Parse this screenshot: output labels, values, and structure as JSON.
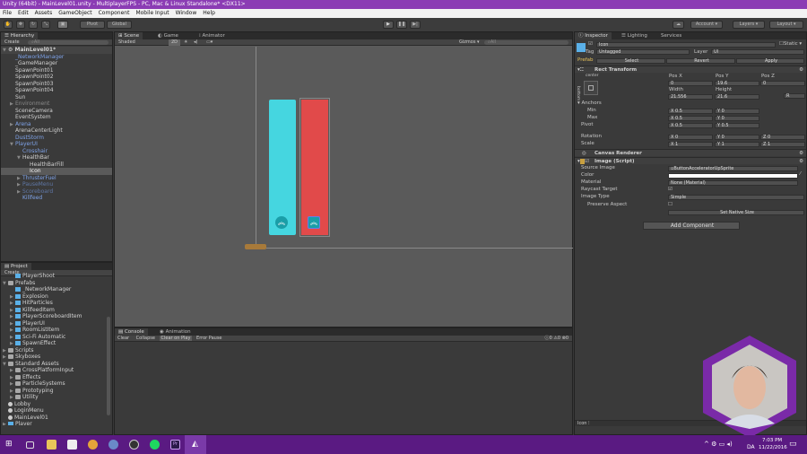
{
  "window": {
    "title": "Unity (64bit) - MainLevel01.unity - MultiplayerFPS - PC, Mac & Linux Standalone* <DX11>"
  },
  "menu": [
    "File",
    "Edit",
    "Assets",
    "GameObject",
    "Component",
    "Mobile Input",
    "Window",
    "Help"
  ],
  "toolbar": {
    "pivot": "Pivot",
    "global": "Global",
    "account": "Account",
    "layers": "Layers",
    "layout": "Layout"
  },
  "hierarchy": {
    "tab": "Hierarchy",
    "create": "Create",
    "search_placeholder": "All",
    "items": [
      {
        "label": "MainLevel01*",
        "indent": 0,
        "type": "sceneroot",
        "arrow": "open"
      },
      {
        "label": "_NetworkManager",
        "indent": 1,
        "type": "prefab"
      },
      {
        "label": "_GameManager",
        "indent": 1,
        "type": "normal"
      },
      {
        "label": "SpawnPoint01",
        "indent": 1,
        "type": "normal"
      },
      {
        "label": "SpawnPoint02",
        "indent": 1,
        "type": "normal"
      },
      {
        "label": "SpawnPoint03",
        "indent": 1,
        "type": "normal"
      },
      {
        "label": "SpawnPoint04",
        "indent": 1,
        "type": "normal"
      },
      {
        "label": "Sun",
        "indent": 1,
        "type": "normal"
      },
      {
        "label": "Environment",
        "indent": 1,
        "type": "inactive",
        "arrow": "closed"
      },
      {
        "label": "SceneCamera",
        "indent": 1,
        "type": "normal"
      },
      {
        "label": "EventSystem",
        "indent": 1,
        "type": "normal"
      },
      {
        "label": "Arena",
        "indent": 1,
        "type": "prefab",
        "arrow": "closed"
      },
      {
        "label": "ArenaCenterLight",
        "indent": 1,
        "type": "normal"
      },
      {
        "label": "DustStorm",
        "indent": 1,
        "type": "prefab"
      },
      {
        "label": "PlayerUI",
        "indent": 1,
        "type": "prefab",
        "arrow": "open"
      },
      {
        "label": "Crosshair",
        "indent": 2,
        "type": "prefab"
      },
      {
        "label": "HealthBar",
        "indent": 2,
        "type": "normal",
        "arrow": "open"
      },
      {
        "label": "HealthBarFill",
        "indent": 3,
        "type": "normal"
      },
      {
        "label": "Icon",
        "indent": 3,
        "type": "normal",
        "selected": true
      },
      {
        "label": "ThrusterFuel",
        "indent": 2,
        "type": "prefab",
        "arrow": "closed"
      },
      {
        "label": "PauseMenu",
        "indent": 2,
        "type": "inprefab",
        "arrow": "closed"
      },
      {
        "label": "Scoreboard",
        "indent": 2,
        "type": "inprefab",
        "arrow": "closed"
      },
      {
        "label": "Killfeed",
        "indent": 2,
        "type": "prefab"
      }
    ]
  },
  "project": {
    "tab": "Project",
    "create": "Create",
    "items": [
      {
        "label": "PlayerShoot",
        "indent": 1,
        "icon": "cube"
      },
      {
        "label": "Prefabs",
        "indent": 0,
        "icon": "folder",
        "arrow": "open"
      },
      {
        "label": "_NetworkManager",
        "indent": 1,
        "icon": "cube"
      },
      {
        "label": "Explosion",
        "indent": 1,
        "icon": "cube",
        "arrow": "closed"
      },
      {
        "label": "HitParticles",
        "indent": 1,
        "icon": "cube",
        "arrow": "closed"
      },
      {
        "label": "KillfeedItem",
        "indent": 1,
        "icon": "cube",
        "arrow": "closed"
      },
      {
        "label": "PlayerScoreboardItem",
        "indent": 1,
        "icon": "cube",
        "arrow": "closed"
      },
      {
        "label": "PlayerUI",
        "indent": 1,
        "icon": "cube",
        "arrow": "closed"
      },
      {
        "label": "RoomListItem",
        "indent": 1,
        "icon": "cube",
        "arrow": "closed"
      },
      {
        "label": "Sci-Fi Automatic",
        "indent": 1,
        "icon": "cube",
        "arrow": "closed"
      },
      {
        "label": "SpawnEffect",
        "indent": 1,
        "icon": "cube",
        "arrow": "closed"
      },
      {
        "label": "Scripts",
        "indent": 0,
        "icon": "folder",
        "arrow": "closed"
      },
      {
        "label": "Skyboxes",
        "indent": 0,
        "icon": "folder",
        "arrow": "closed"
      },
      {
        "label": "Standard Assets",
        "indent": 0,
        "icon": "folder",
        "arrow": "open"
      },
      {
        "label": "CrossPlatformInput",
        "indent": 1,
        "icon": "folder",
        "arrow": "closed"
      },
      {
        "label": "Effects",
        "indent": 1,
        "icon": "folder",
        "arrow": "closed"
      },
      {
        "label": "ParticleSystems",
        "indent": 1,
        "icon": "folder",
        "arrow": "closed"
      },
      {
        "label": "Prototyping",
        "indent": 1,
        "icon": "folder",
        "arrow": "closed"
      },
      {
        "label": "Utility",
        "indent": 1,
        "icon": "folder",
        "arrow": "closed"
      },
      {
        "label": "Lobby",
        "indent": 0,
        "icon": "scene"
      },
      {
        "label": "LoginMenu",
        "indent": 0,
        "icon": "scene"
      },
      {
        "label": "MainLevel01",
        "indent": 0,
        "icon": "scene"
      },
      {
        "label": "Player",
        "indent": 0,
        "icon": "cube",
        "arrow": "closed"
      }
    ]
  },
  "scene": {
    "tabs": [
      "Scene",
      "Game",
      "Animator"
    ],
    "shading": "Shaded",
    "mode2d": "2D",
    "gizmos": "Gizmos",
    "search_placeholder": "All",
    "colors": {
      "left_bar": "#45d6e0",
      "right_bar": "#e14a4a",
      "background": "#5a5a5a"
    }
  },
  "console": {
    "tabs": [
      "Console",
      "Animation"
    ],
    "buttons": [
      "Clear",
      "Collapse",
      "Clear on Play",
      "Error Pause"
    ],
    "counts": {
      "info": "0",
      "warnings": "0",
      "errors": "0"
    }
  },
  "inspector": {
    "tabs": [
      "Inspector",
      "Lighting",
      "Services"
    ],
    "object_name": "Icon",
    "static_label": "Static",
    "tag_label": "Tag",
    "tag": "Untagged",
    "layer_label": "Layer",
    "layer": "UI",
    "prefab_label": "Prefab",
    "prefab_buttons": [
      "Select",
      "Revert",
      "Apply"
    ],
    "rect_transform": {
      "title": "Rect Transform",
      "anchor_h": "center",
      "anchor_v": "bottom",
      "pos_x_label": "Pos X",
      "pos_y_label": "Pos Y",
      "pos_z_label": "Pos Z",
      "pos_x": "0",
      "pos_y": "19.6",
      "pos_z": "0",
      "width_label": "Width",
      "height_label": "Height",
      "width": "21.556",
      "height": "21.6",
      "anchors_label": "Anchors",
      "min_label": "Min",
      "max_label": "Max",
      "min_x": "X 0.5",
      "min_y": "Y 0",
      "max_x": "X 0.5",
      "max_y": "Y 0",
      "pivot_label": "Pivot",
      "pivot_x": "X 0.5",
      "pivot_y": "Y 0.5",
      "rotation_label": "Rotation",
      "rot_x": "X 0",
      "rot_y": "Y 0",
      "rot_z": "Z 0",
      "scale_label": "Scale",
      "scale_x": "X 1",
      "scale_y": "Y 1",
      "scale_z": "Z 1"
    },
    "canvas_renderer": "Canvas Renderer",
    "image": {
      "title": "Image (Script)",
      "source_label": "Source Image",
      "source": "ButtonAcceleratorUpSprite",
      "color_label": "Color",
      "color": "#ffffff",
      "material_label": "Material",
      "material": "None (Material)",
      "raycast_label": "Raycast Target",
      "raycast": true,
      "type_label": "Image Type",
      "type": "Simple",
      "preserve_label": "Preserve Aspect",
      "preserve": false,
      "native_size": "Set Native Size"
    },
    "add_component": "Add Component",
    "preview_label": "Icon"
  },
  "taskbar": {
    "time": "7:03 PM",
    "date": "11/22/2016",
    "lang": "DA"
  }
}
